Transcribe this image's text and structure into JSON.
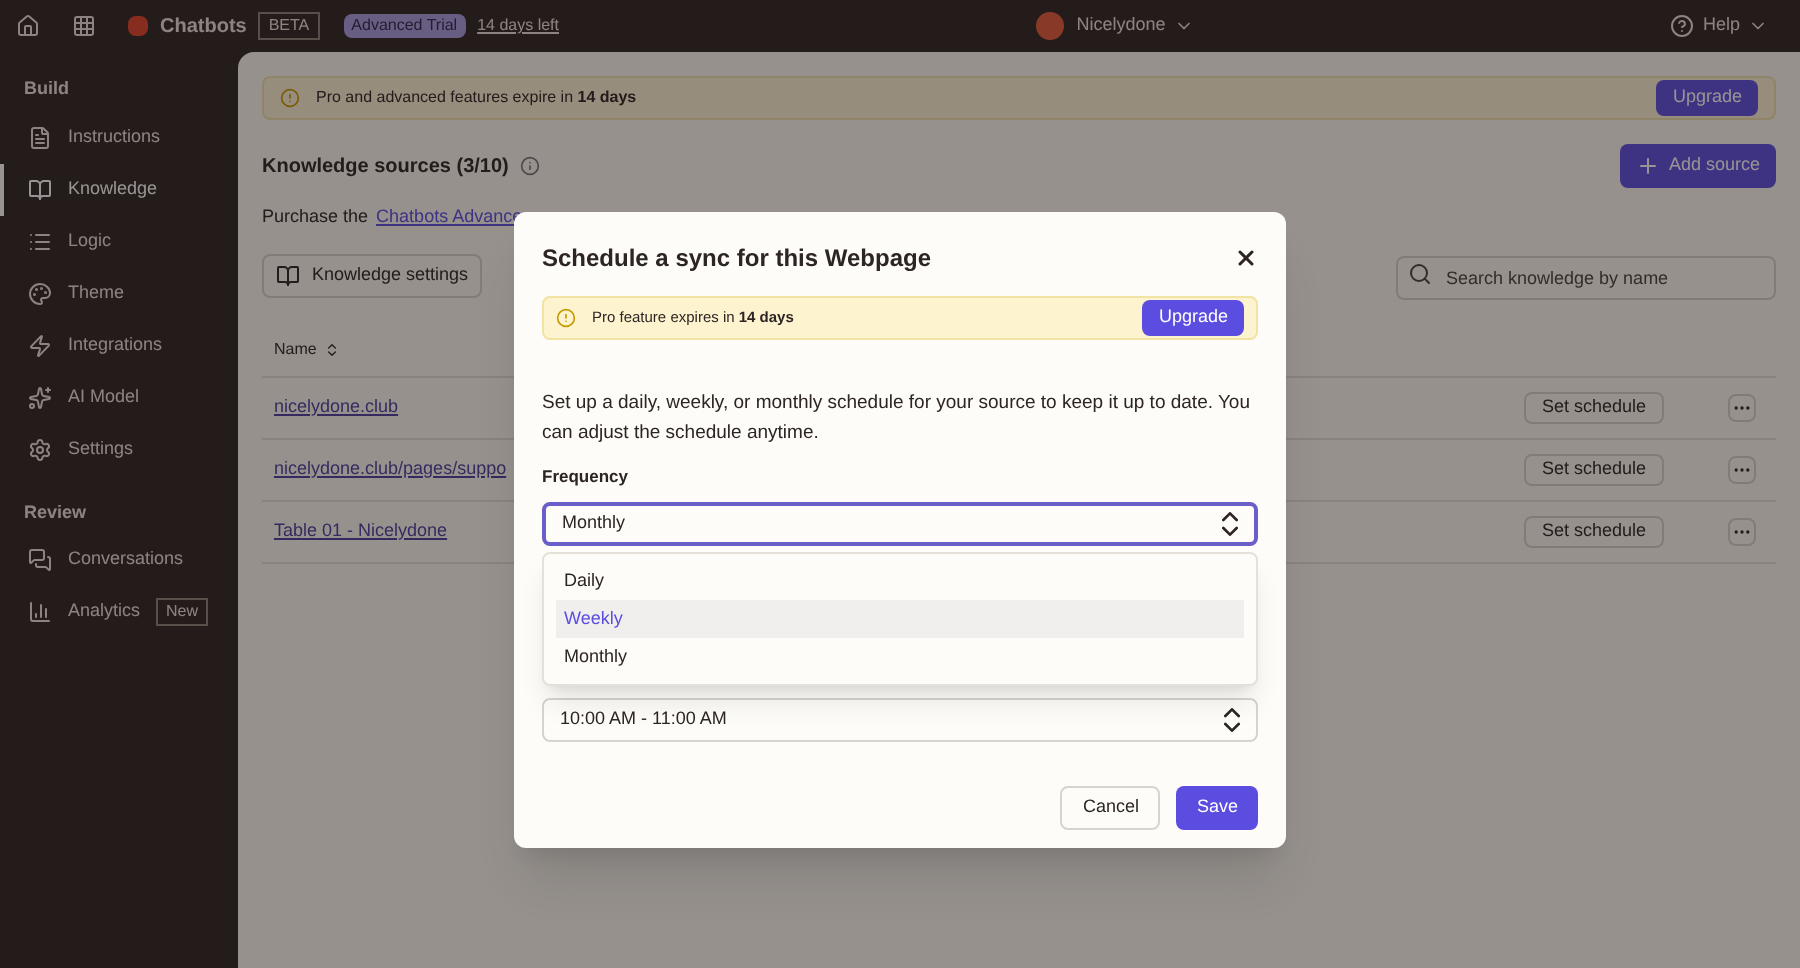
{
  "topbar": {
    "app_name": "Chatbots",
    "app_badge": "BETA",
    "trial_badge": "Advanced Trial",
    "trial_link": "14 days left",
    "workspace": "Nicelydone",
    "help": "Help"
  },
  "sidebar": {
    "sections": [
      {
        "title": "Build",
        "items": [
          {
            "label": "Instructions",
            "selected": false
          },
          {
            "label": "Knowledge",
            "selected": true
          },
          {
            "label": "Logic",
            "selected": false
          },
          {
            "label": "Theme",
            "selected": false
          },
          {
            "label": "Integrations",
            "selected": false
          },
          {
            "label": "AI Model",
            "selected": false
          },
          {
            "label": "Settings",
            "selected": false
          }
        ]
      },
      {
        "title": "Review",
        "items": [
          {
            "label": "Conversations",
            "selected": false
          },
          {
            "label": "Analytics",
            "selected": false,
            "badge": "New"
          }
        ]
      }
    ]
  },
  "banner": {
    "text": "Pro and advanced features expire in **14 days**",
    "button": "Upgrade"
  },
  "knowledge": {
    "title": "Knowledge sources (3/10)",
    "add_button": "Add source",
    "purchase_text": "Purchase the",
    "purchase_link": "Chatbots Advance",
    "settings_button": "Knowledge settings",
    "search": {
      "placeholder": "Search knowledge by name"
    },
    "table": {
      "columns": [
        "Name"
      ],
      "rows": [
        {
          "name": "nicelydone.club",
          "action": "Set schedule"
        },
        {
          "name": "nicelydone.club/pages/suppo",
          "action": "Set schedule"
        },
        {
          "name": "Table 01 - Nicelydone",
          "action": "Set schedule"
        }
      ]
    }
  },
  "modal": {
    "title": "Schedule a sync for this Webpage",
    "notice": {
      "text": "Pro feature expires in **14 days**",
      "button": "Upgrade"
    },
    "description": "Set up a daily, weekly, or monthly schedule for your source to keep it up to date. You can adjust the schedule anytime.",
    "frequency": {
      "label": "Frequency",
      "value": "Monthly",
      "expanded": true,
      "options": [
        {
          "label": "Daily",
          "highlighted": false
        },
        {
          "label": "Weekly",
          "highlighted": true
        },
        {
          "label": "Monthly",
          "highlighted": false
        }
      ]
    },
    "time": {
      "value": "10:00 AM - 11:00 AM"
    },
    "buttons": [
      {
        "label": "Cancel",
        "kind": "secondary"
      },
      {
        "label": "Save",
        "kind": "primary"
      }
    ]
  }
}
